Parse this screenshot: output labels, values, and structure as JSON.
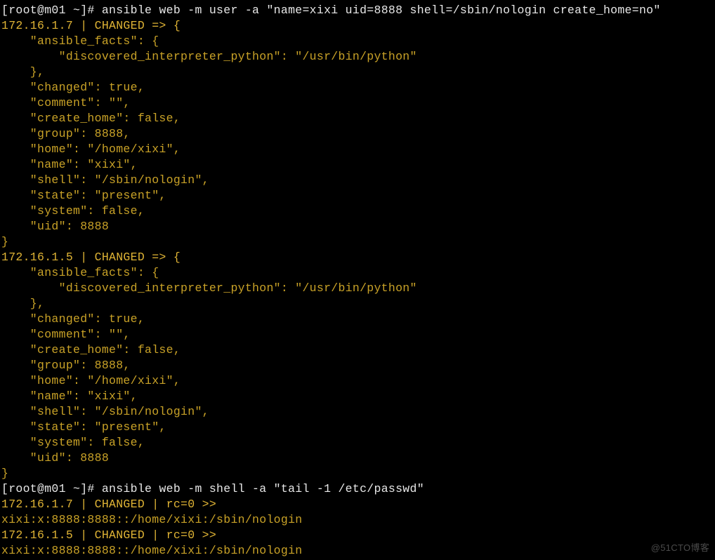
{
  "prompt1": {
    "user_host": "[root@m01 ~]# ",
    "command": "ansible web -m user -a \"name=xixi uid=8888 shell=/sbin/nologin create_home=no\""
  },
  "out1_header": "172.16.1.7 | CHANGED => {",
  "out1_l2": "    \"ansible_facts\": {",
  "out1_l3": "        \"discovered_interpreter_python\": \"/usr/bin/python\"",
  "out1_l4": "    },",
  "out1_l5": "    \"changed\": true,",
  "out1_l6": "    \"comment\": \"\",",
  "out1_l7": "    \"create_home\": false,",
  "out1_l8": "    \"group\": 8888,",
  "out1_l9": "    \"home\": \"/home/xixi\",",
  "out1_l10": "    \"name\": \"xixi\",",
  "out1_l11": "    \"shell\": \"/sbin/nologin\",",
  "out1_l12": "    \"state\": \"present\",",
  "out1_l13": "    \"system\": false,",
  "out1_l14": "    \"uid\": 8888",
  "out1_l15": "}",
  "out2_header": "172.16.1.5 | CHANGED => {",
  "out2_l2": "    \"ansible_facts\": {",
  "out2_l3": "        \"discovered_interpreter_python\": \"/usr/bin/python\"",
  "out2_l4": "    },",
  "out2_l5": "    \"changed\": true,",
  "out2_l6": "    \"comment\": \"\",",
  "out2_l7": "    \"create_home\": false,",
  "out2_l8": "    \"group\": 8888,",
  "out2_l9": "    \"home\": \"/home/xixi\",",
  "out2_l10": "    \"name\": \"xixi\",",
  "out2_l11": "    \"shell\": \"/sbin/nologin\",",
  "out2_l12": "    \"state\": \"present\",",
  "out2_l13": "    \"system\": false,",
  "out2_l14": "    \"uid\": 8888",
  "out2_l15": "}",
  "prompt2": {
    "user_host": "[root@m01 ~]# ",
    "command": "ansible web -m shell -a \"tail -1 /etc/passwd\""
  },
  "out3_l1": "172.16.1.7 | CHANGED | rc=0 >>",
  "out3_l2": "xixi:x:8888:8888::/home/xixi:/sbin/nologin",
  "out3_l3": "172.16.1.5 | CHANGED | rc=0 >>",
  "out3_l4": "xixi:x:8888:8888::/home/xixi:/sbin/nologin",
  "watermark": "@51CTO博客"
}
